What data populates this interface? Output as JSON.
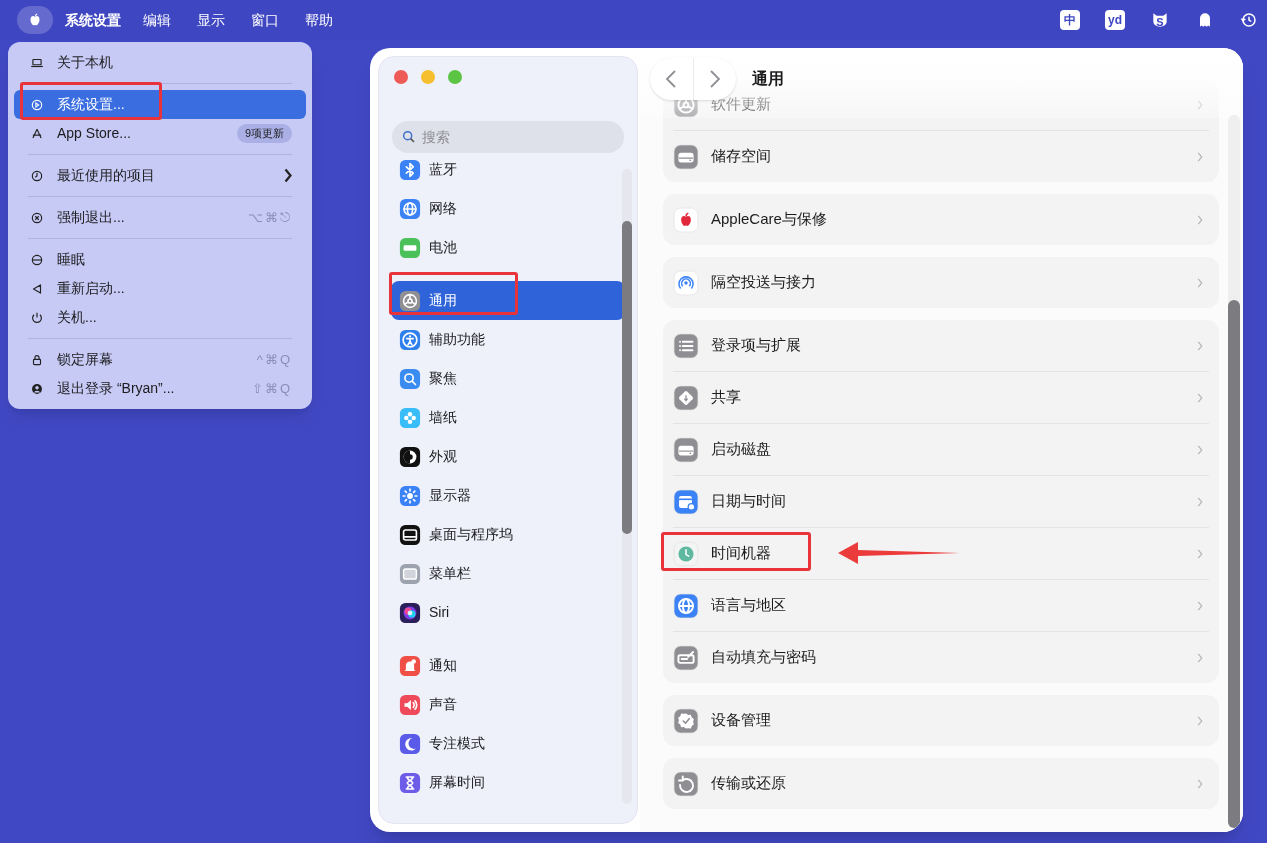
{
  "menubar": {
    "apple_menu_open": true,
    "app_name": "系统设置",
    "menus": [
      "编辑",
      "显示",
      "窗口",
      "帮助"
    ],
    "status_items": [
      {
        "kind": "text-tile",
        "text": "中"
      },
      {
        "kind": "text-tile",
        "text": "yd"
      },
      {
        "kind": "cat",
        "text": "S"
      },
      {
        "kind": "ghost"
      },
      {
        "kind": "clock"
      }
    ]
  },
  "apple_menu": {
    "groups": [
      [
        {
          "label": "关于本机",
          "selected": false,
          "annotated": false,
          "submenu": false
        }
      ],
      [
        {
          "label": "系统设置...",
          "selected": true,
          "annotated": true,
          "submenu": false
        },
        {
          "label": "App Store...",
          "selected": false,
          "annotated": false,
          "submenu": false,
          "badge": "9项更新"
        }
      ],
      [
        {
          "label": "最近使用的项目",
          "selected": false,
          "annotated": false,
          "submenu": true
        }
      ],
      [
        {
          "label": "强制退出...",
          "selected": false,
          "annotated": false,
          "submenu": false,
          "shortcut": "⌥⌘⎋"
        }
      ],
      [
        {
          "label": "睡眠",
          "selected": false,
          "annotated": false,
          "submenu": false
        },
        {
          "label": "重新启动...",
          "selected": false,
          "annotated": false,
          "submenu": false
        },
        {
          "label": "关机...",
          "selected": false,
          "annotated": false,
          "submenu": false
        }
      ],
      [
        {
          "label": "锁定屏幕",
          "selected": false,
          "annotated": false,
          "submenu": false,
          "shortcut": "^⌘Q"
        },
        {
          "label": "退出登录 “Bryan”...",
          "selected": false,
          "annotated": false,
          "submenu": false,
          "shortcut": "⇧⌘Q"
        }
      ]
    ]
  },
  "settings_window": {
    "sidebar": {
      "search": {
        "placeholder": "搜索"
      },
      "groups": [
        [
          {
            "label": "蓝牙",
            "selected": false,
            "annotated": false
          },
          {
            "label": "网络",
            "selected": false,
            "annotated": false
          },
          {
            "label": "电池",
            "selected": false,
            "annotated": false
          }
        ],
        [
          {
            "label": "通用",
            "selected": true,
            "annotated": true
          },
          {
            "label": "辅助功能",
            "selected": false,
            "annotated": false
          },
          {
            "label": "聚焦",
            "selected": false,
            "annotated": false
          },
          {
            "label": "墙纸",
            "selected": false,
            "annotated": false
          },
          {
            "label": "外观",
            "selected": false,
            "annotated": false
          },
          {
            "label": "显示器",
            "selected": false,
            "annotated": false
          },
          {
            "label": "桌面与程序坞",
            "selected": false,
            "annotated": false
          },
          {
            "label": "菜单栏",
            "selected": false,
            "annotated": false
          },
          {
            "label": "Siri",
            "selected": false,
            "annotated": false
          }
        ],
        [
          {
            "label": "通知",
            "selected": false,
            "annotated": false
          },
          {
            "label": "声音",
            "selected": false,
            "annotated": false
          },
          {
            "label": "专注模式",
            "selected": false,
            "annotated": false
          },
          {
            "label": "屏幕时间",
            "selected": false,
            "annotated": false
          }
        ]
      ]
    },
    "header": {
      "title": "通用"
    },
    "groups": [
      [
        {
          "label": "软件更新",
          "annotated": false
        },
        {
          "label": "储存空间",
          "annotated": false
        }
      ],
      [
        {
          "label": "AppleCare与保修",
          "annotated": false
        }
      ],
      [
        {
          "label": "隔空投送与接力",
          "annotated": false
        }
      ],
      [
        {
          "label": "登录项与扩展",
          "annotated": false
        },
        {
          "label": "共享",
          "annotated": false
        },
        {
          "label": "启动磁盘",
          "annotated": false
        },
        {
          "label": "日期与时间",
          "annotated": false
        },
        {
          "label": "时间机器",
          "annotated": true
        },
        {
          "label": "语言与地区",
          "annotated": false
        },
        {
          "label": "自动填充与密码",
          "annotated": false
        }
      ],
      [
        {
          "label": "设备管理",
          "annotated": false
        }
      ],
      [
        {
          "label": "传输或还原",
          "annotated": false
        }
      ]
    ]
  }
}
